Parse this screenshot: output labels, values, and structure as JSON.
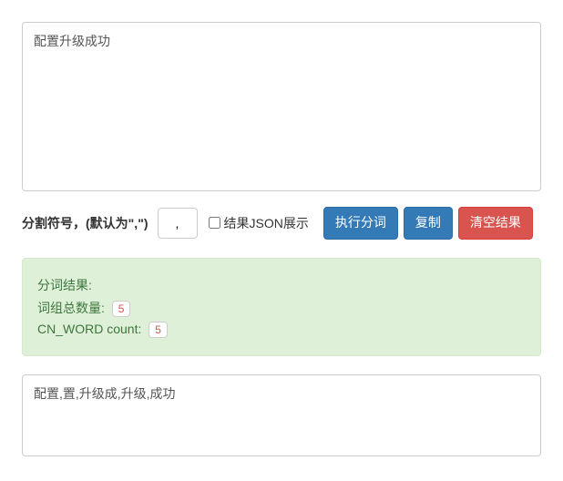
{
  "input": {
    "value": "配置升级成功"
  },
  "controls": {
    "separator_label": "分割符号，(默认为\",\")",
    "separator_value": ",",
    "json_checkbox_label": "结果JSON展示",
    "json_checked": false,
    "run_button": "执行分词",
    "copy_button": "复制",
    "clear_button": "清空结果"
  },
  "result": {
    "title": "分词结果:",
    "total_label": "词组总数量: ",
    "total_value": "5",
    "cn_label": "CN_WORD count: ",
    "cn_value": "5"
  },
  "output": {
    "value": "配置,置,升级成,升级,成功"
  }
}
